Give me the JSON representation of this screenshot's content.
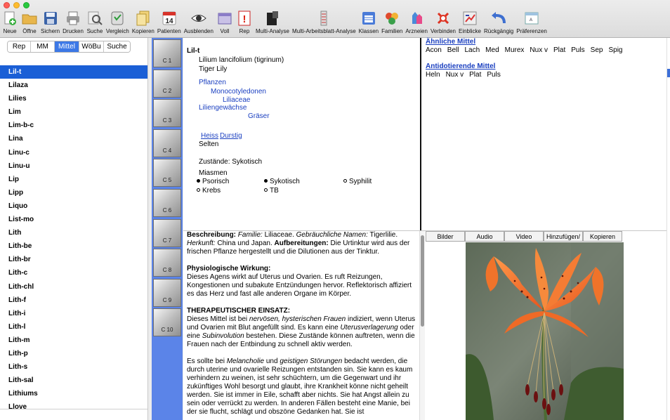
{
  "window": {
    "traffic_lights": [
      "close",
      "minimize",
      "maximize"
    ]
  },
  "toolbar": {
    "items": [
      {
        "label": "Neue",
        "icon": "new-icon"
      },
      {
        "label": "Öffne",
        "icon": "open-folder-icon"
      },
      {
        "label": "Sichern",
        "icon": "save-disk-icon"
      },
      {
        "label": "Drucken",
        "icon": "printer-icon"
      },
      {
        "label": "Suche",
        "icon": "search-icon"
      },
      {
        "label": "Vergleich",
        "icon": "compare-icon"
      },
      {
        "label": "Kopieren",
        "icon": "copy-icon"
      },
      {
        "label": "Patienten",
        "icon": "calendar-icon",
        "badge": "14"
      },
      {
        "label": "Ausblenden",
        "icon": "eye-icon"
      },
      {
        "label": "Voll",
        "icon": "window-full-icon"
      },
      {
        "label": "Rep",
        "icon": "repertory-alert-icon"
      },
      {
        "label": "Multi-Analyse",
        "icon": "multi-analysis-icon"
      },
      {
        "label": "Multi-Arbeitsblatt-Analyse",
        "icon": "worksheet-analysis-icon"
      },
      {
        "label": "Klassen",
        "icon": "classes-icon"
      },
      {
        "label": "Familien",
        "icon": "families-icon"
      },
      {
        "label": "Arzneien",
        "icon": "remedies-icon"
      },
      {
        "label": "Verbinden",
        "icon": "connect-icon"
      },
      {
        "label": "Einblicke",
        "icon": "insights-icon"
      },
      {
        "label": "Rückgängig",
        "icon": "undo-icon"
      },
      {
        "label": "Präferenzen",
        "icon": "preferences-icon"
      }
    ]
  },
  "sidebar": {
    "segments": [
      {
        "label": "Rep",
        "active": false
      },
      {
        "label": "MM",
        "active": false
      },
      {
        "label": "Mittel",
        "active": true
      },
      {
        "label": "WöBu",
        "active": false
      },
      {
        "label": "Suche",
        "active": false
      }
    ],
    "remedies": [
      "Lil-t",
      "Lilaza",
      "Lilies",
      "Lim",
      "Lim-b-c",
      "Lina",
      "Linu-c",
      "Linu-u",
      "Lip",
      "Lipp",
      "Liquo",
      "List-mo",
      "Lith",
      "Lith-be",
      "Lith-br",
      "Lith-c",
      "Lith-chl",
      "Lith-f",
      "Lith-i",
      "Lith-l",
      "Lith-m",
      "Lith-p",
      "Lith-s",
      "Lith-sal",
      "Lithiums",
      "Llove"
    ],
    "selected_index": 0
  },
  "chapters": [
    "C 1",
    "C 2",
    "C 3",
    "C 4",
    "C 5",
    "C 6",
    "C 7",
    "C 8",
    "C 9",
    "C 10"
  ],
  "info": {
    "abbrev": "Lil-t",
    "latin": "Lilium lancifolium  (tigrinum)",
    "common": "Tiger Lily",
    "kingdom": "Pflanzen",
    "class": "Monocotyledonen",
    "family": "Liliaceae",
    "family_de": "Liliengewächse",
    "group": "Gräser",
    "themes": [
      "Heiss",
      "Durstig"
    ],
    "theme_plain": "Selten",
    "states": "Zustände: Sykotisch",
    "miasms_label": "Miasmen",
    "miasms": [
      {
        "name": "Psorisch",
        "filled": true
      },
      {
        "name": "Sykotisch",
        "filled": true
      },
      {
        "name": "Syphilit",
        "filled": false
      },
      {
        "name": "Krebs",
        "filled": false
      },
      {
        "name": "TB",
        "filled": false
      }
    ]
  },
  "related": {
    "similar_title": "Ähnliche Mittel",
    "similar": [
      "Acon",
      "Bell",
      "Lach",
      "Med",
      "Murex",
      "Nux v",
      "Plat",
      "Puls",
      "Sep",
      "Spig"
    ],
    "antidote_title": "Antidotierende Mittel",
    "antidotes": [
      "Heln",
      "Nux v",
      "Plat",
      "Puls"
    ]
  },
  "description": {
    "p1_b1": "Beschreibung:",
    "p1_i1": "Familie:",
    "p1_t1": " Liliaceae. ",
    "p1_i2": "Gebräuchliche Namen:",
    "p1_t2": " Tigerlilie. ",
    "p1_i3": "Herkunft:",
    "p1_t3": " China und Japan. ",
    "p1_b2": "Aufbereitungen:",
    "p1_t4": " Die Urtinktur wird aus der frischen Pflanze hergestellt und die Dilutionen aus der Tinktur.",
    "p2_h": "Physiologische Wirkung:",
    "p2_t": "Dieses Agens wirkt auf Uterus und Ovarien. Es ruft Reizungen, Kongestionen und subakute Entzündungen hervor. Reflektorisch affiziert es das Herz und fast alle anderen Organe im Körper.",
    "p3_h": "THERAPEUTISCHER EINSATZ:",
    "p3_t1": "Dieses Mittel ist bei ",
    "p3_i1": "nervösen, hysterischen Frauen",
    "p3_t2": " indiziert, wenn Uterus und Ovarien mit Blut angefüllt sind. Es kann eine ",
    "p3_i2": "Uterusverlagerung",
    "p3_t3": " oder eine ",
    "p3_i3": "Subinvolution",
    "p3_t4": " bestehen. Diese Zustände können auftreten, wenn die Frauen nach der Entbindung zu schnell aktiv werden.",
    "p4_t1": "Es sollte bei ",
    "p4_i1": "Melancholie",
    "p4_t2": " und ",
    "p4_i2": "geistigen Störungen",
    "p4_t3": " bedacht werden, die durch uterine und ovarielle Reizungen entstanden sin. Sie kann es kaum verhindern zu weinen, ist sehr schüchtern, um die Gegenwart und ihr zukünftiges Wohl besorgt und glaubt, ihre Krankheit könne nicht geheilt werden. Sie ist immer in Eile, schafft aber nichts. Sie hat Angst allein zu sein oder verrückt zu werden. In anderen Fällen besteht eine Manie, bei der sie flucht, schlägt und obszöne Gedanken hat. Sie ist"
  },
  "media": {
    "tabs": [
      "Bilder",
      "Audio",
      "Video",
      "Hinzufügen/",
      "Kopieren"
    ],
    "image_subject": "tiger-lily-flower-photo"
  },
  "colors": {
    "selection": "#1a5fd6",
    "chapter_column": "#5b84e8",
    "link_blue": "#1a3fc0",
    "segment_active": "#3c78e6"
  }
}
